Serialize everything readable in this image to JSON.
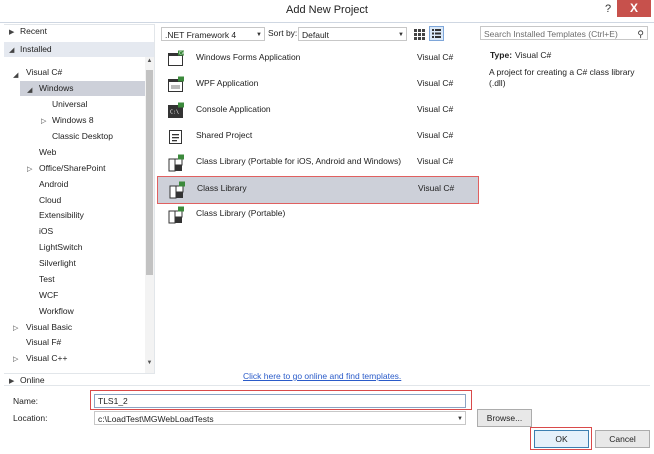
{
  "window": {
    "title": "Add New Project",
    "help_glyph": "?",
    "close_glyph": "X"
  },
  "left_panel": {
    "recent": "Recent",
    "installed": "Installed",
    "tree": {
      "visual_csharp": "Visual C#",
      "windows": "Windows",
      "universal": "Universal",
      "windows8": "Windows 8",
      "classic_desktop": "Classic Desktop",
      "web": "Web",
      "office_sharepoint": "Office/SharePoint",
      "android": "Android",
      "cloud": "Cloud",
      "extensibility": "Extensibility",
      "ios": "iOS",
      "lightswitch": "LightSwitch",
      "silverlight": "Silverlight",
      "test": "Test",
      "wcf": "WCF",
      "workflow": "Workflow",
      "visual_basic": "Visual Basic",
      "visual_fsharp": "Visual F#",
      "visual_cpp": "Visual C++"
    },
    "online": "Online"
  },
  "toolbar": {
    "framework": ".NET Framework 4",
    "sort_label": "Sort by:",
    "sort_value": "Default",
    "search_placeholder": "Search Installed Templates (Ctrl+E)"
  },
  "templates": [
    {
      "name": "Windows Forms Application",
      "lang": "Visual C#",
      "icon": "windows-forms-icon"
    },
    {
      "name": "WPF Application",
      "lang": "Visual C#",
      "icon": "wpf-icon"
    },
    {
      "name": "Console Application",
      "lang": "Visual C#",
      "icon": "console-icon"
    },
    {
      "name": "Shared Project",
      "lang": "Visual C#",
      "icon": "shared-project-icon"
    },
    {
      "name": "Class Library (Portable for iOS, Android and Windows)",
      "lang": "Visual C#",
      "icon": "class-library-icon"
    },
    {
      "name": "Class Library",
      "lang": "Visual C#",
      "icon": "class-library-icon"
    },
    {
      "name": "Class Library (Portable)",
      "lang": "",
      "icon": "class-library-icon"
    }
  ],
  "description": {
    "type_label": "Type:",
    "type_value": "Visual C#",
    "text": "A project for creating a C# class library (.dll)"
  },
  "online_link": "Click here to go online and find templates.",
  "form": {
    "name_label": "Name:",
    "name_value": "TLS1_2",
    "location_label": "Location:",
    "location_value": "c:\\LoadTest\\MGWebLoadTests",
    "browse": "Browse...",
    "ok": "OK",
    "cancel": "Cancel"
  }
}
